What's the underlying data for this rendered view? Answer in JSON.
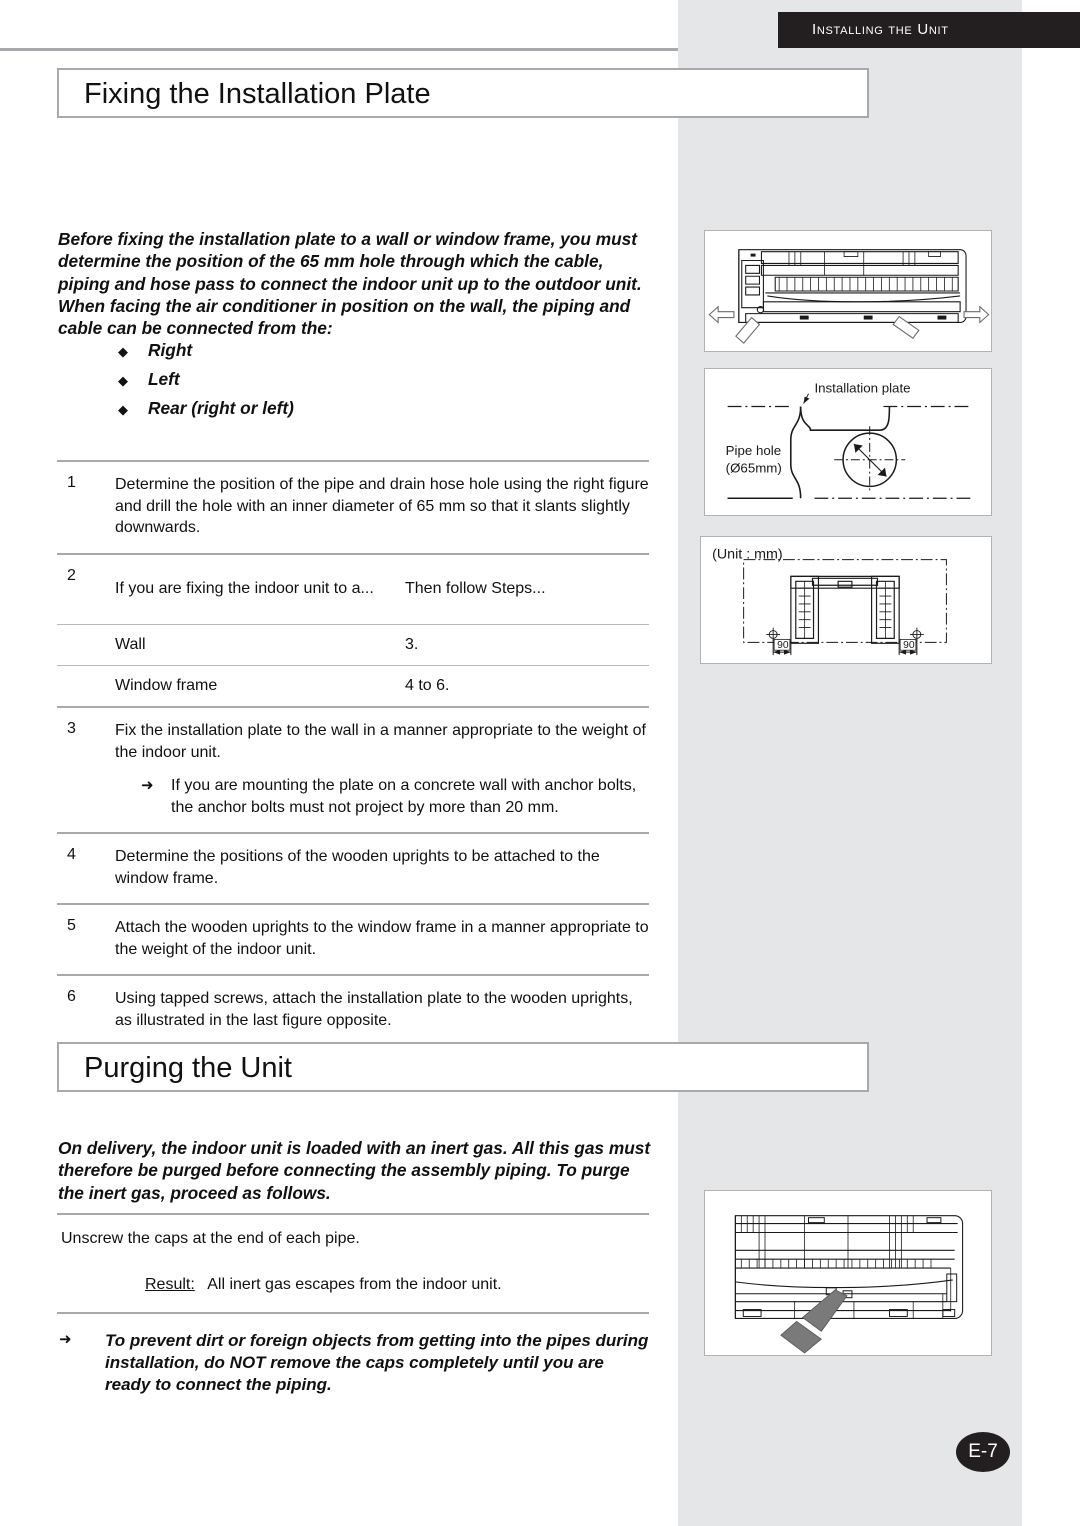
{
  "header": {
    "running_head": "Installing the Unit"
  },
  "page": {
    "number": "E-7"
  },
  "sections": [
    {
      "title": "Fixing the Installation Plate",
      "intro": "Before fixing the installation plate to a wall or window frame, you must determine the position of the 65 mm hole through which the cable, piping and hose pass to connect the indoor unit up to the outdoor unit. When facing the air conditioner in position on the wall, the piping and cable can be connected from the:",
      "bullets": [
        {
          "mark": "◆",
          "label": "Right"
        },
        {
          "mark": "◆",
          "label": "Left"
        },
        {
          "mark": "◆",
          "label": "Rear (right or left)"
        }
      ],
      "steps": [
        {
          "num": "1",
          "text": "Determine the position of the pipe and drain hose hole using the right figure and drill the hole with an inner diameter of 65 mm so that it slants slightly downwards."
        },
        {
          "num": "2",
          "table": {
            "header_left": "If you are fixing the indoor unit to a...",
            "header_right": "Then follow Steps...",
            "rows": [
              {
                "left": "Wall",
                "right": "3."
              },
              {
                "left": "Window frame",
                "right": "4 to 6."
              }
            ]
          }
        },
        {
          "num": "3",
          "text": "Fix the installation plate to the wall in a manner appropriate to the weight of the indoor unit.",
          "substep": {
            "mark": "➜",
            "text": "If you are mounting the plate on a concrete wall with anchor bolts, the anchor bolts must not project by more than 20 mm."
          }
        },
        {
          "num": "4",
          "text": "Determine the positions of the wooden uprights to be attached to the window frame."
        },
        {
          "num": "5",
          "text": "Attach the wooden uprights to the window frame in a manner appropriate to the weight of the indoor unit."
        },
        {
          "num": "6",
          "text": "Using tapped screws, attach the installation plate to the wooden uprights, as illustrated in the last figure opposite."
        }
      ]
    },
    {
      "title": "Purging the Unit",
      "intro": "On delivery, the indoor unit is loaded with an inert gas. All this gas must therefore be purged before connecting the assembly piping. To purge the inert gas, proceed as follows.",
      "instruction": "Unscrew the caps at the end of each pipe.",
      "result_label": "Result:",
      "result_text": "All inert gas escapes from the indoor unit.",
      "warning": {
        "mark": "➜",
        "text": "To prevent dirt or foreign objects from getting into the pipes during installation, do NOT remove the caps completely until you are ready to connect the piping."
      }
    }
  ],
  "figures": [
    {
      "name": "indoor-unit-piping-directions",
      "caption": "",
      "labels": []
    },
    {
      "name": "pipe-hole-position",
      "caption": "",
      "labels": [
        {
          "text": "Installation plate"
        },
        {
          "text": "Pipe hole"
        },
        {
          "text": "(Ø65mm)"
        }
      ]
    },
    {
      "name": "wooden-uprights-dimensions",
      "caption": "",
      "labels": [
        {
          "text": "(Unit : mm)"
        },
        {
          "text": "90"
        },
        {
          "text": "90"
        }
      ]
    },
    {
      "name": "indoor-unit-caps-location",
      "caption": "",
      "labels": []
    }
  ],
  "colors": {
    "band_gray": "#e4e6e8",
    "header_black": "#231f20",
    "rule_gray": "#a7a9ac"
  }
}
